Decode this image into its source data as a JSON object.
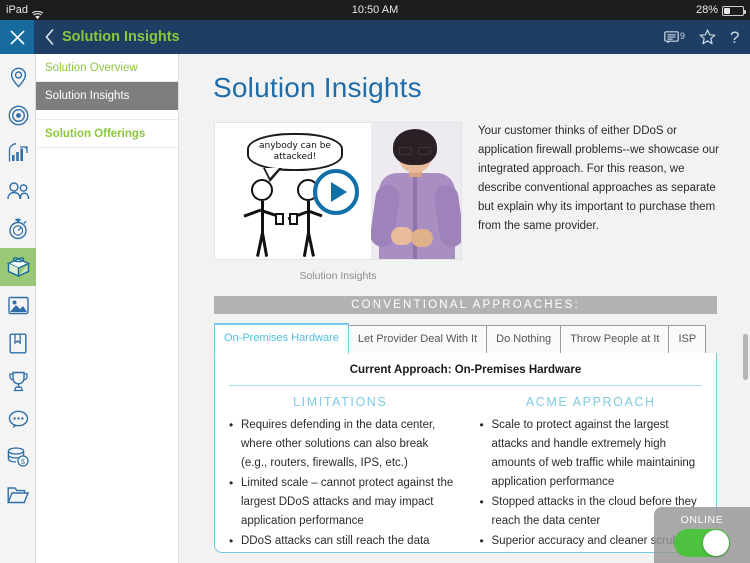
{
  "status_bar": {
    "device": "iPad",
    "wifi_icon": "wifi-icon",
    "time": "10:50 AM",
    "battery_percent": "28%"
  },
  "app_bar": {
    "close_icon": "close-icon",
    "back_icon": "chevron-left-icon",
    "title": "Solution Insights",
    "comments_icon": "comment-bubble-icon",
    "comments_count": "9",
    "favorite_icon": "star-icon",
    "help_icon": "question-mark-icon"
  },
  "icon_rail": {
    "items": [
      {
        "icon": "location-pin-icon",
        "active": false
      },
      {
        "icon": "target-bullseye-icon",
        "active": false
      },
      {
        "icon": "bar-chart-growth-icon",
        "active": false
      },
      {
        "icon": "people-group-icon",
        "active": false
      },
      {
        "icon": "stopwatch-icon",
        "active": false
      },
      {
        "icon": "package-box-icon",
        "active": true
      },
      {
        "icon": "image-photo-icon",
        "active": false
      },
      {
        "icon": "book-icon",
        "active": false
      },
      {
        "icon": "trophy-icon",
        "active": false
      },
      {
        "icon": "chat-bubble-icon",
        "active": false
      },
      {
        "icon": "money-stack-icon",
        "active": false
      },
      {
        "icon": "folder-icon",
        "active": false
      }
    ]
  },
  "nav_list": {
    "items": [
      {
        "label": "Solution Overview",
        "selected": false,
        "bold": false
      },
      {
        "label": "Solution Insights",
        "selected": true,
        "bold": false
      },
      {
        "label": "Solution Offerings",
        "selected": false,
        "bold": true
      }
    ]
  },
  "main": {
    "page_title": "Solution Insights",
    "video": {
      "play_icon": "play-button-icon",
      "whiteboard_speech": "anybody can be attacked!",
      "caption": "Solution Insights"
    },
    "description": "Your customer thinks of either DDoS or application firewall problems--we showcase our integrated approach. For this reason, we describe conventional approaches as separate but explain why its important to purchase them from the same provider.",
    "banner": "CONVENTIONAL APPROACHES:",
    "tabs": [
      {
        "label": "On-Premises Hardware",
        "active": true
      },
      {
        "label": "Let Provider Deal With It",
        "active": false
      },
      {
        "label": "Do Nothing",
        "active": false
      },
      {
        "label": "Throw People at It",
        "active": false
      },
      {
        "label": "ISP",
        "active": false
      }
    ],
    "panel": {
      "title": "Current Approach: On-Premises Hardware",
      "columns": [
        {
          "heading": "LIMITATIONS",
          "bullets": [
            "Requires defending in the data center, where other solutions can also break (e.g., routers, firewalls, IPS, etc.)",
            "Limited scale – cannot protect against the largest DDoS attacks and may impact application performance",
            "DDoS attacks can still reach the data"
          ]
        },
        {
          "heading": "ACME APPROACH",
          "bullets": [
            "Scale to protect against the largest attacks and handle extremely high amounts of web traffic while maintaining application performance",
            "Stopped attacks in the cloud before they reach the data center",
            "Superior accuracy and cleaner scrubbing"
          ]
        }
      ]
    },
    "online_widget": {
      "label": "ONLINE",
      "state": "on"
    }
  },
  "colors": {
    "app_bar": "#1e3f63",
    "accent_green": "#8cc63e",
    "accent_blue": "#1f6ca8",
    "tab_active": "#4fbfe0",
    "toggle_on": "#4cc23f",
    "banner_gray": "#b2b2b2"
  }
}
